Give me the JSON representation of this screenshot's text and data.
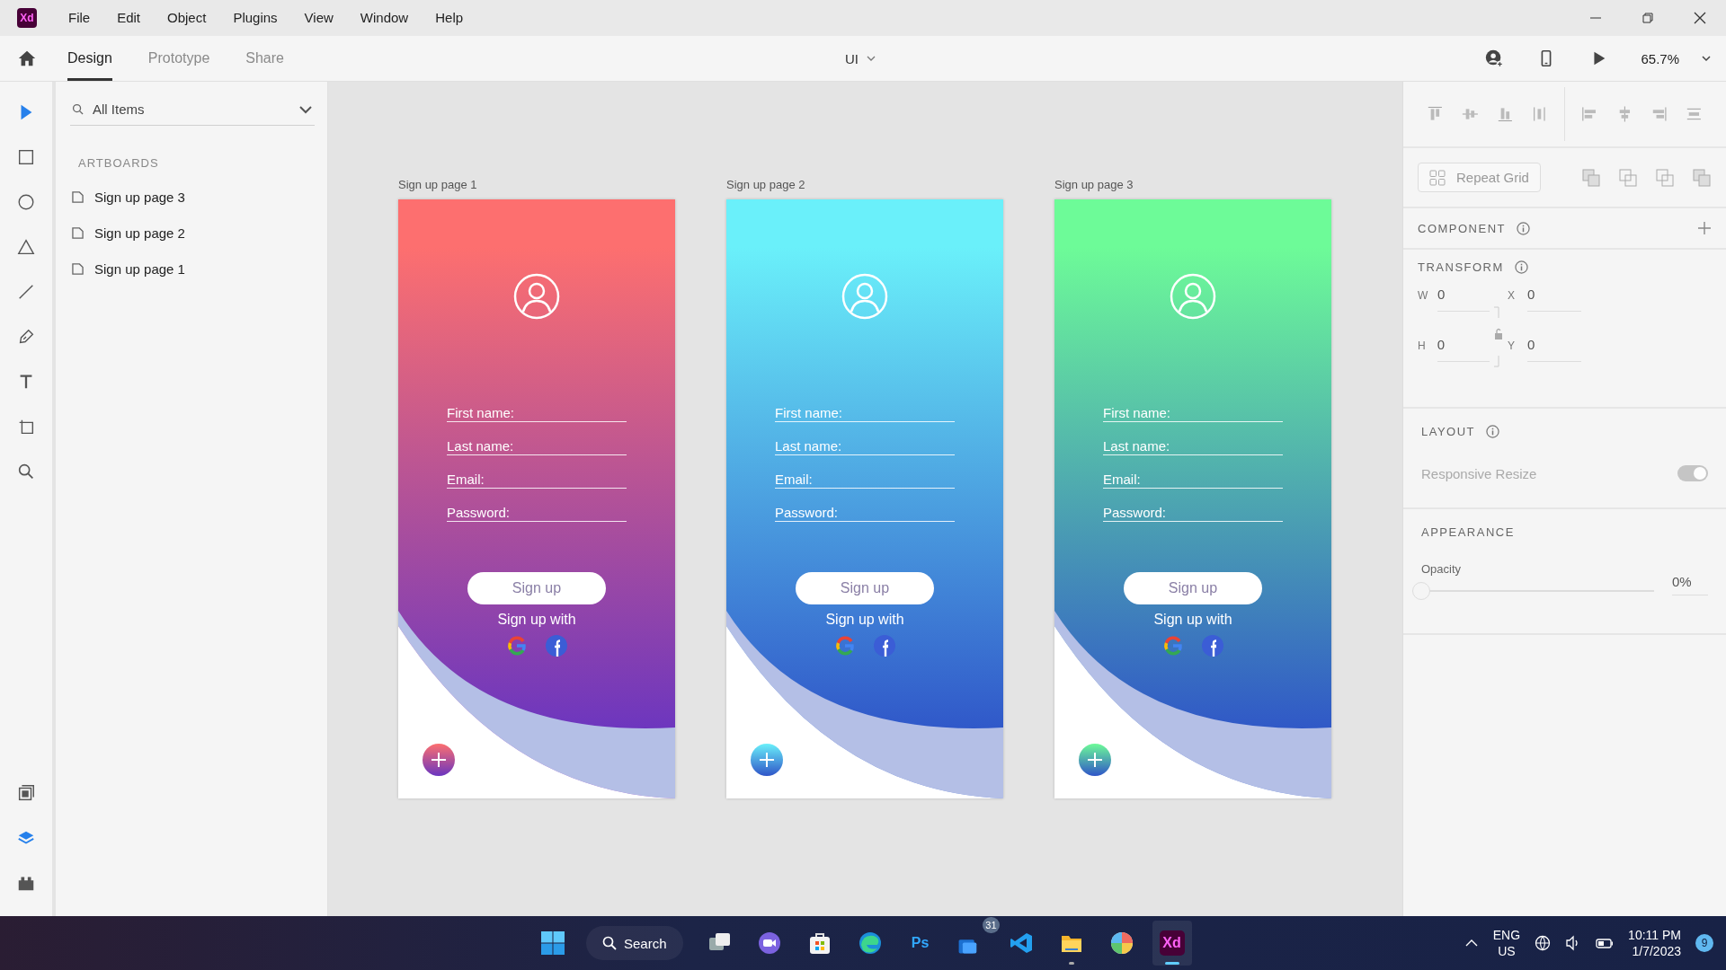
{
  "app": {
    "logo": "Xd"
  },
  "menu": [
    "File",
    "Edit",
    "Object",
    "Plugins",
    "View",
    "Window",
    "Help"
  ],
  "tabs": [
    {
      "label": "Design",
      "selected": true
    },
    {
      "label": "Prototype",
      "selected": false
    },
    {
      "label": "Share",
      "selected": false
    }
  ],
  "document": {
    "title": "UI"
  },
  "zoom": {
    "value": "65.7%"
  },
  "tools": [
    {
      "kind": "select",
      "selected": true
    },
    {
      "kind": "rectangle",
      "selected": false
    },
    {
      "kind": "ellipse",
      "selected": false
    },
    {
      "kind": "triangle",
      "selected": false
    },
    {
      "kind": "line",
      "selected": false
    },
    {
      "kind": "pen",
      "selected": false
    },
    {
      "kind": "text",
      "selected": false
    },
    {
      "kind": "artboard",
      "selected": false
    },
    {
      "kind": "zoom",
      "selected": false
    }
  ],
  "panel_tools": [
    {
      "kind": "assets",
      "selected": false
    },
    {
      "kind": "layers",
      "selected": true
    },
    {
      "kind": "plugins",
      "selected": false
    }
  ],
  "layers": {
    "filter": "All Items",
    "section": "ARTBOARDS",
    "items": [
      "Sign up page 3",
      "Sign up page 2",
      "Sign up page 1"
    ]
  },
  "artboards": [
    {
      "title": "Sign up page 1",
      "color": "#fd6f6f",
      "kind": "warm",
      "fields": [
        "First name:",
        "Last name:",
        "Email:",
        "Password:"
      ],
      "button": "Sign up",
      "social_label": "Sign up with"
    },
    {
      "title": "Sign up page 2",
      "color": "#6af0fa",
      "kind": "cool",
      "fields": [
        "First name:",
        "Last name:",
        "Email:",
        "Password:"
      ],
      "button": "Sign up",
      "social_label": "Sign up with"
    },
    {
      "title": "Sign up page 3",
      "color": "#6dfb98",
      "kind": "cool",
      "fields": [
        "First name:",
        "Last name:",
        "Email:",
        "Password:"
      ],
      "button": "Sign up",
      "social_label": "Sign up with"
    }
  ],
  "properties": {
    "repeat_grid": "Repeat Grid",
    "component": "COMPONENT",
    "transform": "TRANSFORM",
    "fields": [
      {
        "label": "W",
        "value": "0"
      },
      {
        "label": "X",
        "value": "0"
      },
      {
        "label": "H",
        "value": "0"
      },
      {
        "label": "Y",
        "value": "0"
      }
    ],
    "layout": "LAYOUT",
    "responsive_resize": {
      "label": "Responsive Resize",
      "on": true,
      "disabled": true
    },
    "appearance": "APPEARANCE",
    "opacity": {
      "label": "Opacity",
      "level": 0,
      "value": "0%"
    }
  },
  "taskbar": {
    "search": "Search",
    "apps": [
      {
        "kind": "taskview",
        "running": false,
        "active": false
      },
      {
        "kind": "camera",
        "running": false,
        "active": false
      },
      {
        "kind": "store",
        "running": false,
        "active": false
      },
      {
        "kind": "browser",
        "running": false,
        "active": false
      },
      {
        "kind": "ps",
        "label": "Ps",
        "running": false,
        "active": false
      },
      {
        "kind": "mail",
        "badge": "31",
        "running": false,
        "active": false
      },
      {
        "kind": "code",
        "running": false,
        "active": false
      },
      {
        "kind": "folder",
        "running": true,
        "active": false
      },
      {
        "kind": "photos",
        "running": false,
        "active": false
      },
      {
        "kind": "xd",
        "label": "Xd",
        "running": true,
        "active": true
      }
    ],
    "tray": {
      "language": "ENG",
      "region": "US",
      "time": "10:11 PM",
      "date": "1/7/2023",
      "notifications": "9"
    }
  }
}
